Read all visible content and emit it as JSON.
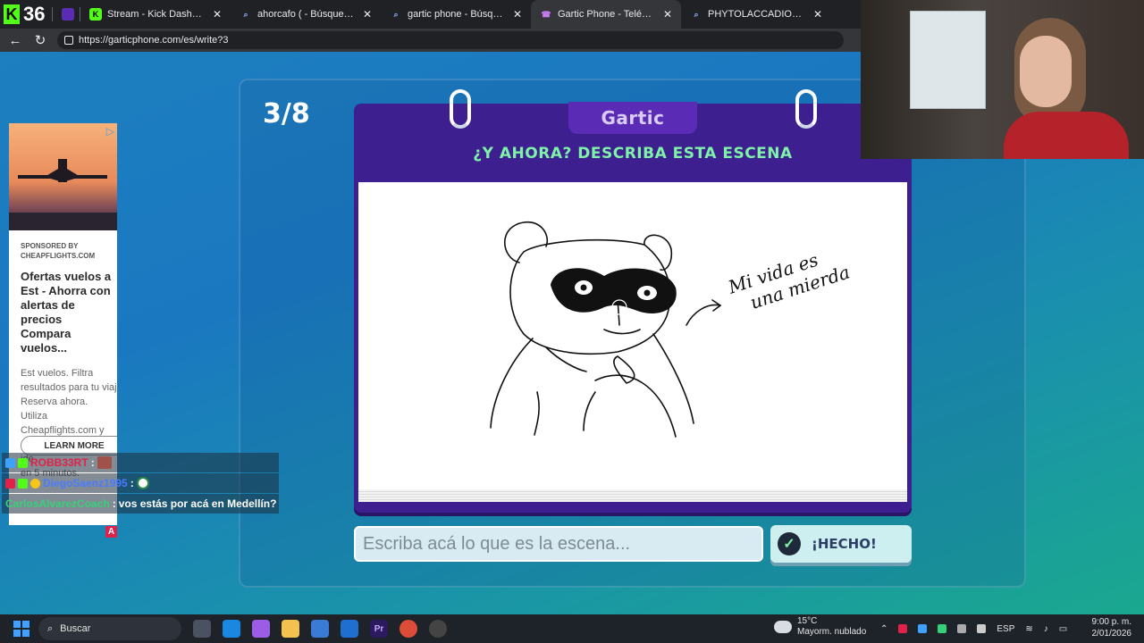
{
  "stream_overlay": {
    "kick_count": "36"
  },
  "browser": {
    "tabs": [
      {
        "title": "Stream - Kick Dashboard",
        "favicon": "kick-icon",
        "color": "#53fc18",
        "active": false
      },
      {
        "title": "ahorcafo ( - Búsqueda",
        "favicon": "search-icon",
        "color": "#4285f4",
        "active": false
      },
      {
        "title": "gartic phone - Búsqueda",
        "favicon": "search-icon",
        "color": "#4285f4",
        "active": false
      },
      {
        "title": "Gartic Phone - Teléfono Descon",
        "favicon": "phone-icon",
        "color": "#b14ad6",
        "active": true
      },
      {
        "title": "PHYTOLACCADIOICA - Búsque",
        "favicon": "search-icon",
        "color": "#4285f4",
        "active": false
      }
    ],
    "url": "https://garticphone.com/es/write?3"
  },
  "game": {
    "round": "3/8",
    "brand": "Gartic",
    "prompt": "¿Y AHORA? DESCRIBA ESTA ESCENA",
    "drawing_caption_line1": "Mi vida es",
    "drawing_caption_line2": "una mierda",
    "answer_placeholder": "Escriba acá lo que es la escena...",
    "done_label": "¡HECHO!",
    "accent": "#7ef2a8",
    "card_color": "#3e1f8f"
  },
  "ad": {
    "sponsor": "SPONSORED BY\nCHEAPFLIGHTS.COM",
    "title": "Ofertas vuelos a\nEst - Ahorra con\nalertas de precios\nCompara vuelos...",
    "body": "Est vuelos. Filtra\nresultados para tu viaj\nReserva ahora. Utiliza\nCheapflights.com y\nencuentra tu vuelo ide\nen 5 minutos.",
    "cta": "LEARN MORE"
  },
  "chat": [
    {
      "user": "ROBB33RT",
      "color": "#e0224a",
      "message": ""
    },
    {
      "user": "DiegoSaenz1995",
      "color": "#4a7bff",
      "message": ""
    },
    {
      "user": "CarlosAlvarezCoach",
      "color": "#33d17a",
      "message": "vos estás por acá en Medellín?"
    }
  ],
  "chat_separator": ":",
  "chat_a_badge": "A",
  "taskbar": {
    "search_label": "Buscar",
    "weather_temp": "15°C",
    "weather_desc": "Mayorm. nublado",
    "lang": "ESP",
    "time": "9:00 p. m.",
    "date": "2/01/2026"
  }
}
